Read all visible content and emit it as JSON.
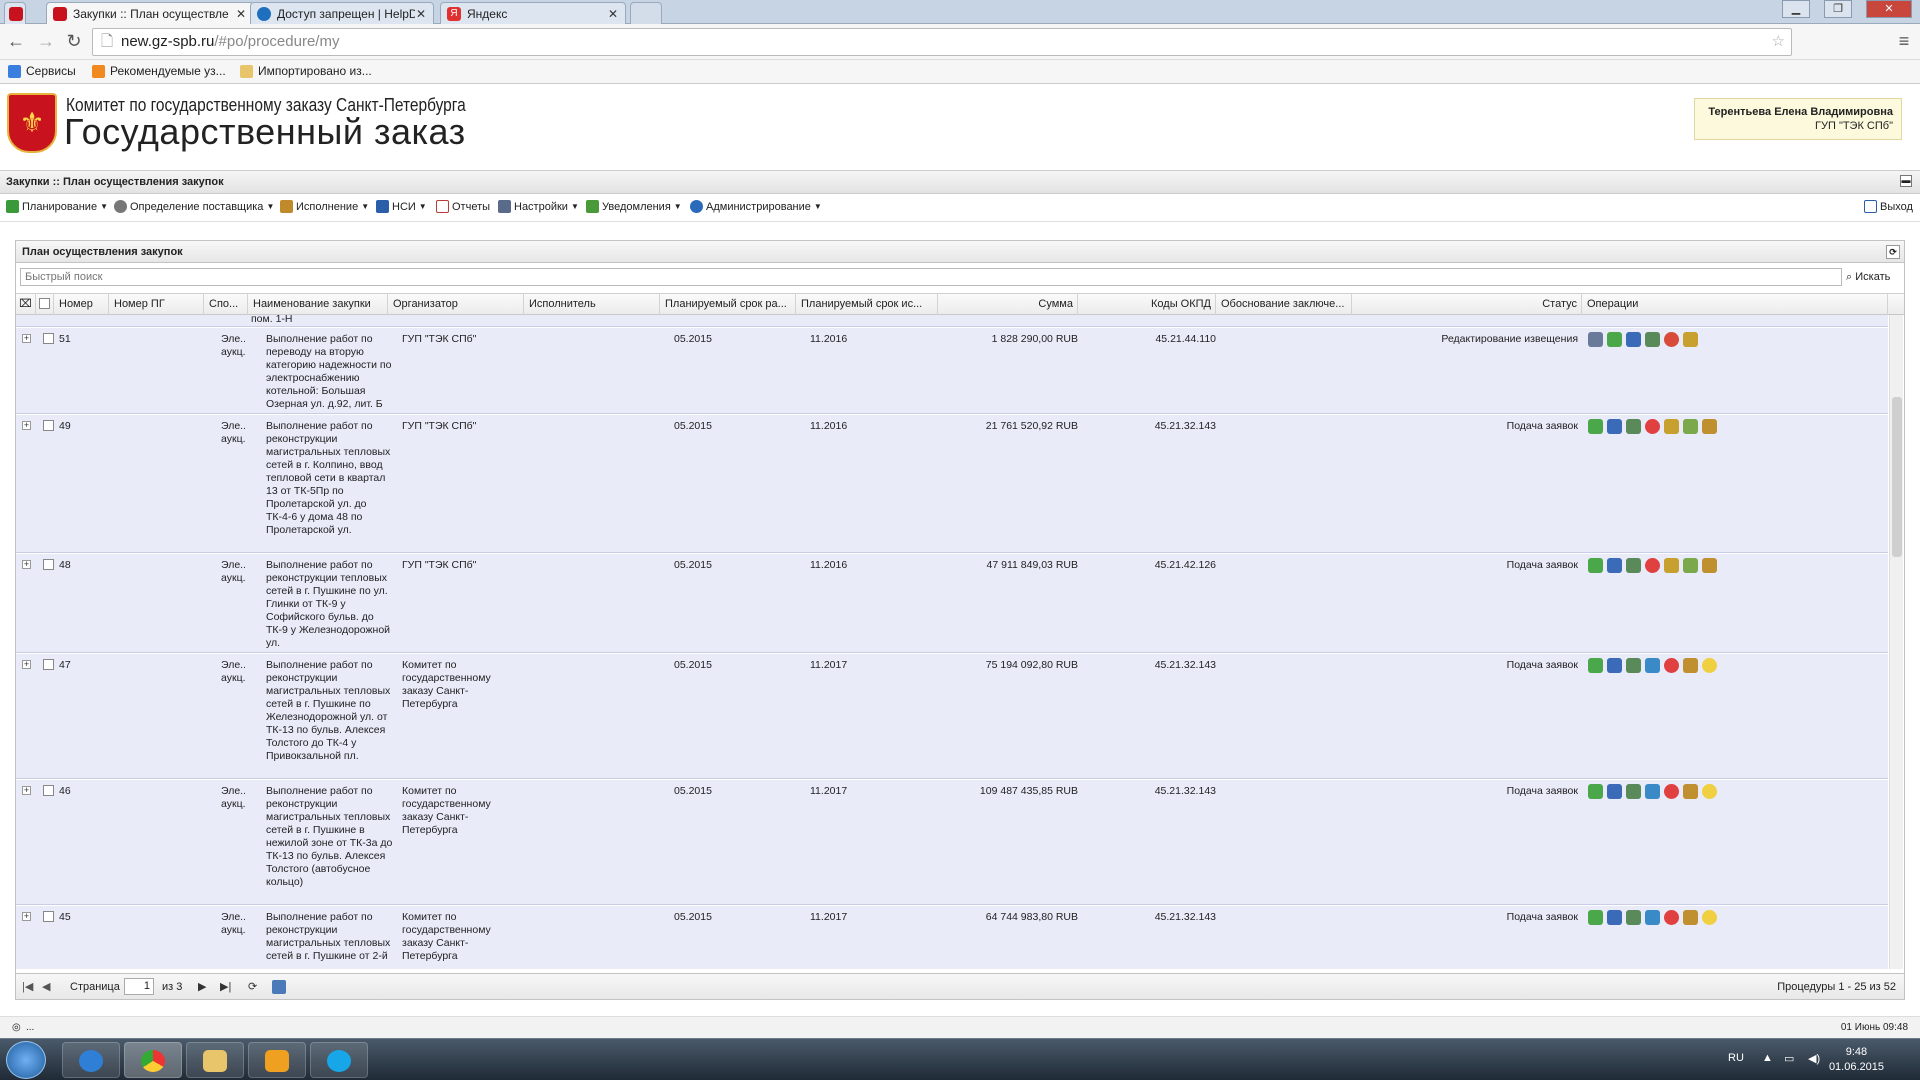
{
  "browser": {
    "tabs": [
      {
        "title": "Закупки :: План осуществле",
        "favicon_color": "#c8121e",
        "active": true
      },
      {
        "title": "Доступ запрещен | HelpD",
        "favicon_color": "#1f6fbf",
        "active": false
      },
      {
        "title": "Яндекс",
        "favicon_color": "#e03030",
        "active": false
      }
    ],
    "url_host": "new.gz-spb.ru",
    "url_path": "/#po/procedure/my",
    "bookmarks": [
      {
        "label": "Сервисы"
      },
      {
        "label": "Рекомендуемые уз..."
      },
      {
        "label": "Импортировано из..."
      }
    ]
  },
  "header": {
    "org_name": "Комитет по государственному заказу Санкт-Петербурга",
    "brand": "Государственный заказ",
    "user_name": "Терентьева Елена Владимировна",
    "user_org": "ГУП \"ТЭК СПб\""
  },
  "appbar": {
    "title": "Закупки :: План осуществления закупок"
  },
  "menu": {
    "items": [
      {
        "label": "Планирование",
        "color": "#3a9a3a"
      },
      {
        "label": "Определение поставщика",
        "color": "#777777"
      },
      {
        "label": "Исполнение",
        "color": "#c08a2a"
      },
      {
        "label": "НСИ",
        "color": "#2a5ea8"
      },
      {
        "label": "Отчеты",
        "color": "#b83a3a"
      },
      {
        "label": "Настройки",
        "color": "#5a6a8a"
      },
      {
        "label": "Уведомления",
        "color": "#4a9a3a"
      },
      {
        "label": "Администрирование",
        "color": "#2a6ab8"
      }
    ],
    "logout": "Выход"
  },
  "panel": {
    "title": "План осуществления закупок",
    "search_placeholder": "Быстрый поиск",
    "search_button": "Искать",
    "columns": [
      "Номер",
      "Номер ПГ",
      "Спо...",
      "Наименование закупки",
      "Организатор",
      "Исполнитель",
      "Планируемый срок ра...",
      "Планируемый срок ис...",
      "Сумма",
      "Коды ОКПД",
      "Обоснование заключе...",
      "Статус",
      "Операции"
    ],
    "partial_row_text": "пом. 1-Н",
    "rows": [
      {
        "num": "51",
        "method": "Эле... аукц...",
        "name": "Выполнение работ по переводу на вторую категорию надежности по электроснабжению котельной: Большая Озерная ул. д.92, лит. Б",
        "organizer": "ГУП \"ТЭК СПб\"",
        "start": "05.2015",
        "end": "11.2016",
        "sum": "1 828 290,00 RUB",
        "okpd": "45.21.44.110",
        "status": "Редактирование извещения",
        "ops": [
          "edit-icon",
          "publish-icon",
          "stats-icon",
          "settings-icon",
          "refresh-icon",
          "emblem-icon"
        ]
      },
      {
        "num": "49",
        "method": "Эле... аукц...",
        "name": "Выполнение работ по реконструкции магистральных тепловых сетей в г. Колпино, ввод тепловой сети в квартал 13 от ТК-5Пр по Пролетарской ул. до ТК-4-6 у дома 48 по Пролетарской ул.",
        "organizer": "ГУП \"ТЭК СПб\"",
        "start": "05.2015",
        "end": "11.2016",
        "sum": "21 761 520,92 RUB",
        "okpd": "45.21.32.143",
        "status": "Подача заявок",
        "ops": [
          "publish-icon",
          "stats-icon",
          "settings-icon",
          "cancel-icon",
          "emblem-icon",
          "document-icon",
          "protocol-icon"
        ]
      },
      {
        "num": "48",
        "method": "Эле... аукц...",
        "name": "Выполнение работ по реконструкции тепловых сетей в г. Пушкине по ул. Глинки от ТК-9 у Софийского бульв. до ТК-9 у Железнодорожной ул.",
        "organizer": "ГУП \"ТЭК СПб\"",
        "start": "05.2015",
        "end": "11.2016",
        "sum": "47 911 849,03 RUB",
        "okpd": "45.21.42.126",
        "status": "Подача заявок",
        "ops": [
          "publish-icon",
          "stats-icon",
          "settings-icon",
          "cancel-icon",
          "emblem-icon",
          "document-icon",
          "protocol-icon"
        ]
      },
      {
        "num": "47",
        "method": "Эле... аукц...",
        "name": "Выполнение работ по реконструкции магистральных тепловых сетей в г. Пушкине по Железнодорожной ул. от ТК-13 по бульв. Алексея Толстого до ТК-4 у Привокзальной пл.",
        "organizer": "Комитет по государственному заказу Санкт-Петербурга",
        "start": "05.2015",
        "end": "11.2017",
        "sum": "75 194 092,80 RUB",
        "okpd": "45.21.32.143",
        "status": "Подача заявок",
        "ops": [
          "publish-icon",
          "stats-icon",
          "settings-icon",
          "map-icon",
          "cancel-icon",
          "protocol-icon",
          "sun-icon"
        ]
      },
      {
        "num": "46",
        "method": "Эле... аукц...",
        "name": "Выполнение работ по реконструкции магистральных тепловых сетей в г. Пушкине в нежилой зоне от ТК-3а до ТК-13 по бульв. Алексея Толстого (автобусное кольцо)",
        "organizer": "Комитет по государственному заказу Санкт-Петербурга",
        "start": "05.2015",
        "end": "11.2017",
        "sum": "109 487 435,85 RUB",
        "okpd": "45.21.32.143",
        "status": "Подача заявок",
        "ops": [
          "publish-icon",
          "stats-icon",
          "settings-icon",
          "map-icon",
          "cancel-icon",
          "protocol-icon",
          "sun-icon"
        ]
      },
      {
        "num": "45",
        "method": "Эле... аукц...",
        "name": "Выполнение работ по реконструкции магистральных тепловых сетей в г. Пушкине от 2-й",
        "organizer": "Комитет по государственному заказу Санкт-Петербурга",
        "start": "05.2015",
        "end": "11.2017",
        "sum": "64 744 983,80 RUB",
        "okpd": "45.21.32.143",
        "status": "Подача заявок",
        "ops": [
          "publish-icon",
          "stats-icon",
          "settings-icon",
          "map-icon",
          "cancel-icon",
          "protocol-icon",
          "sun-icon"
        ]
      }
    ],
    "pager": {
      "page_label": "Страница",
      "page": "1",
      "of": "из 3",
      "summary": "Процедуры 1 - 25 из 52"
    }
  },
  "statusbar": {
    "left": "...",
    "right": "01 Июнь 09:48"
  },
  "taskbar": {
    "lang": "RU",
    "time": "9:48",
    "date": "01.06.2015"
  },
  "colors": {
    "row_bg": "#e9ebf9",
    "accent_red": "#c8121e"
  }
}
